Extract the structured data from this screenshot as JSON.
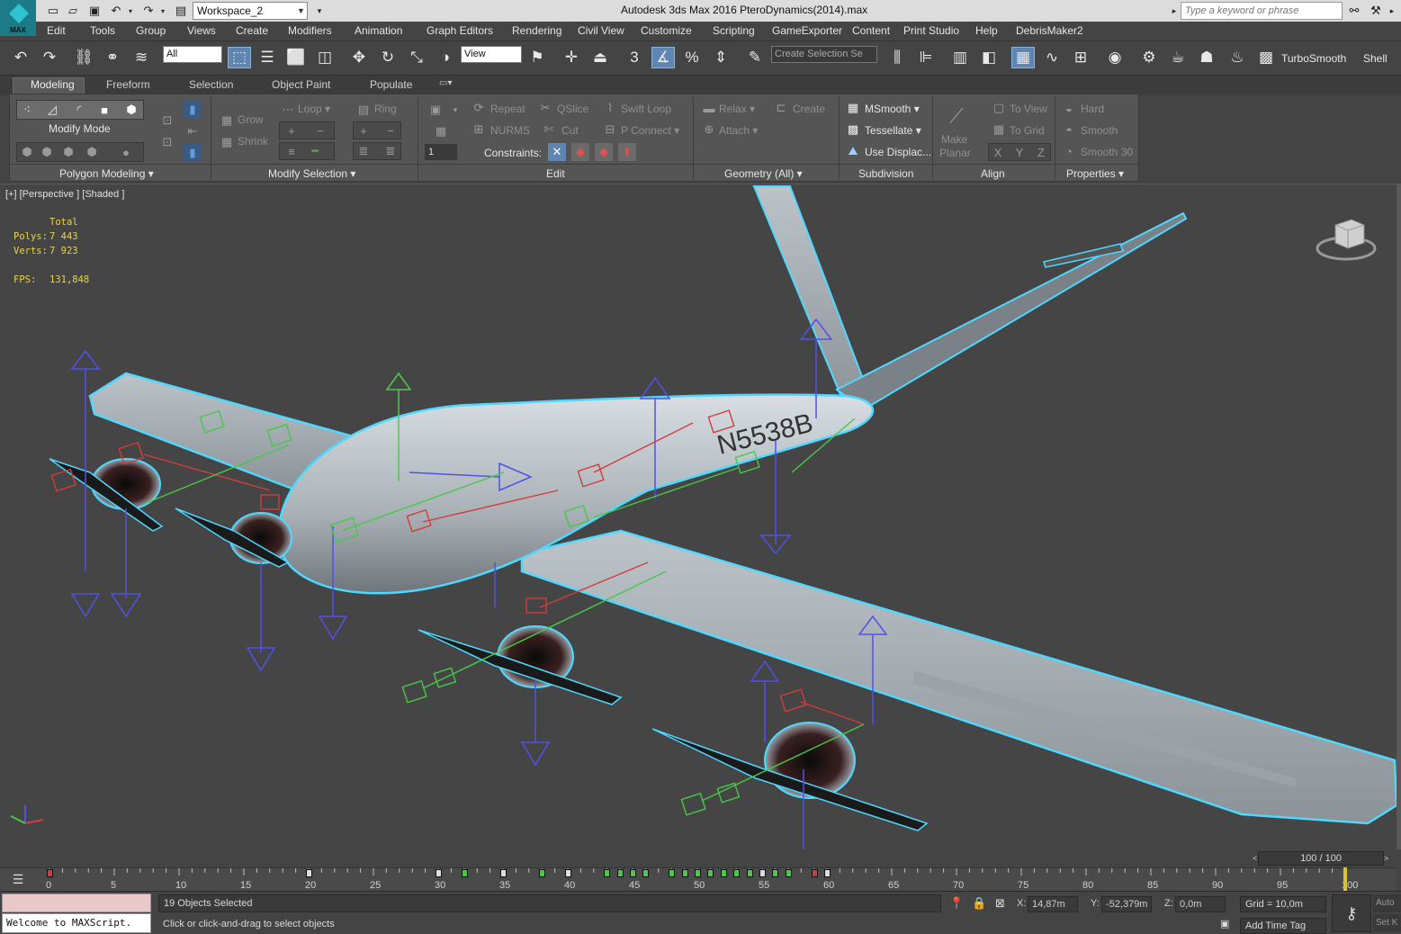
{
  "titlebar": {
    "workspace": "Workspace_2",
    "window_title": "Autodesk 3ds Max 2016     PteroDynamics(2014).max",
    "search_placeholder": "Type a keyword or phrase",
    "logo_text": "MAX"
  },
  "menu": [
    "Edit",
    "Tools",
    "Group",
    "Views",
    "Create",
    "Modifiers",
    "Animation",
    "Graph Editors",
    "Rendering",
    "Civil View",
    "Customize",
    "Scripting",
    "GameExporter",
    "Content",
    "Print Studio",
    "Help",
    "DebrisMaker2"
  ],
  "toolbar": {
    "selection_filter": "All",
    "ref_coord": "View",
    "named_selection_placeholder": "Create Selection Se",
    "snap_label": "3",
    "turbosmooth": "TurboSmooth",
    "shell": "Shell"
  },
  "ribbon": {
    "tabs": [
      "Modeling",
      "Freeform",
      "Selection",
      "Object Paint",
      "Populate"
    ],
    "modify_mode": "Modify Mode",
    "polygon_modeling": "Polygon Modeling",
    "grow": "Grow",
    "shrink": "Shrink",
    "loop": "Loop",
    "ring": "Ring",
    "modify_selection": "Modify Selection",
    "repeat": "Repeat",
    "qslice": "QSlice",
    "swift_loop": "Swift Loop",
    "nurms": "NURMS",
    "cut": "Cut",
    "p_connect": "P Connect",
    "constraints": "Constraints:",
    "spinner_value": "1",
    "edit": "Edit",
    "relax": "Relax",
    "create": "Create",
    "attach": "Attach",
    "geometry_all": "Geometry (All)",
    "msmooth": "MSmooth",
    "tessellate": "Tessellate",
    "use_displac": "Use Displac...",
    "subdivision": "Subdivision",
    "make": "Make",
    "planar": "Planar",
    "to_view": "To View",
    "to_grid": "To Grid",
    "x": "X",
    "y": "Y",
    "z": "Z",
    "align": "Align",
    "hard": "Hard",
    "smooth": "Smooth",
    "smooth30": "Smooth 30",
    "properties": "Properties"
  },
  "viewport": {
    "label": "[+] [Perspective ] [Shaded ]",
    "stats_total": "Total",
    "polys_label": "Polys:",
    "polys_value": "7 443",
    "verts_label": "Verts:",
    "verts_value": "7 923",
    "fps_label": "FPS:",
    "fps_value": "131,848",
    "tail_registration": "N5538B"
  },
  "timeline": {
    "slider": "100 / 100",
    "current_frame": 100,
    "ticks": [
      "0",
      "5",
      "10",
      "15",
      "20",
      "25",
      "30",
      "35",
      "40",
      "45",
      "50",
      "55",
      "60",
      "65",
      "70",
      "75",
      "80",
      "85",
      "90",
      "95",
      "100"
    ]
  },
  "status": {
    "maxscript": "Welcome to MAXScript.",
    "selected": "19 Objects Selected",
    "prompt": "Click or click-and-drag to select objects",
    "x_label": "X:",
    "x_value": "14,87m",
    "y_label": "Y:",
    "y_value": "-52,379m",
    "z_label": "Z:",
    "z_value": "0,0m",
    "grid": "Grid = 10,0m",
    "add_time_tag": "Add Time Tag",
    "auto_key": "Auto",
    "set_key": "Set K"
  },
  "colors": {
    "accent": "#5f86b3",
    "selection_outline": "#4fd8ff",
    "stat_text": "#e7d44a",
    "viewport_bg": "#454545"
  }
}
